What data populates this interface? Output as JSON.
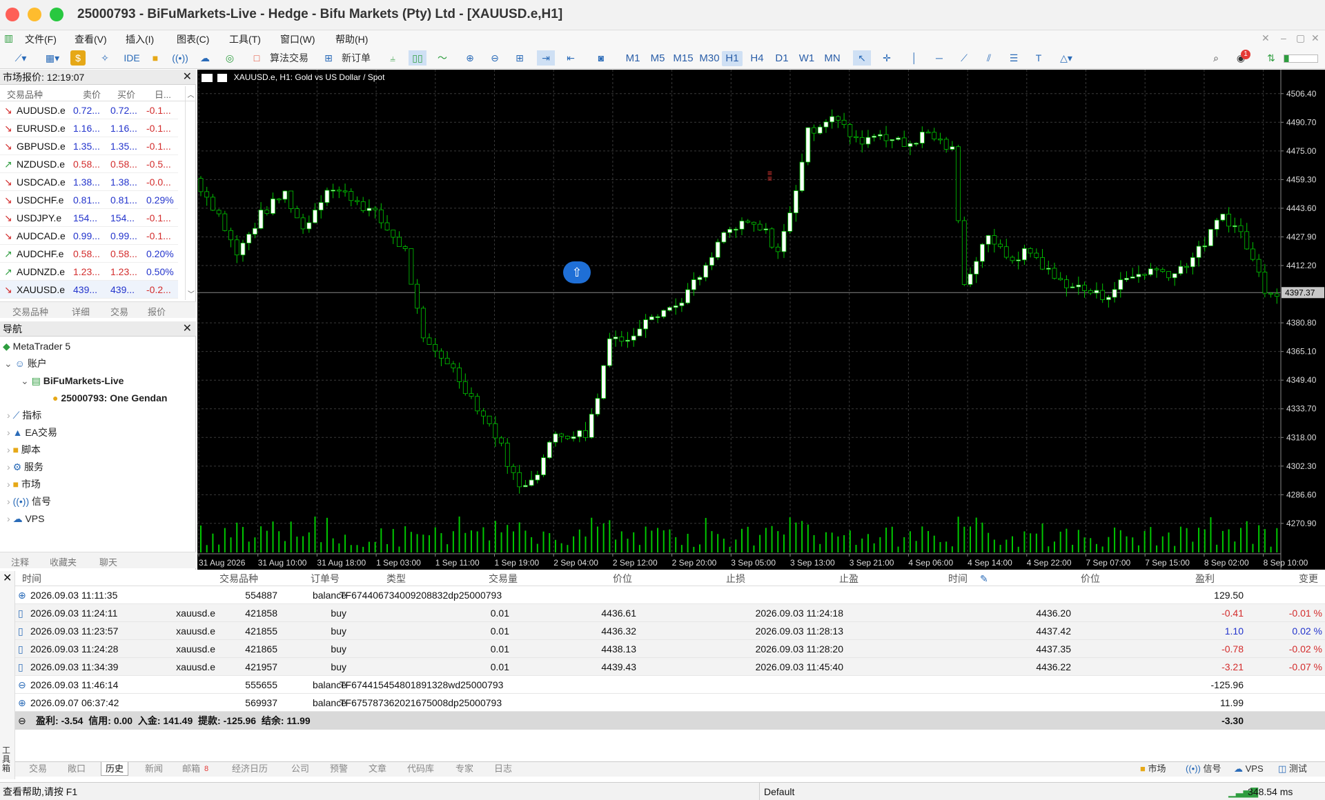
{
  "window": {
    "title": "25000793 - BiFuMarkets-Live - Hedge - Bifu Markets (Pty) Ltd - [XAUUSD.e,H1]"
  },
  "menu": [
    "文件(F)",
    "查看(V)",
    "插入(I)",
    "图表(C)",
    "工具(T)",
    "窗口(W)",
    "帮助(H)"
  ],
  "toolbar": {
    "ide_label": "IDE",
    "algo_label": "算法交易",
    "new_order_label": "新订单",
    "timeframes": [
      "M1",
      "M5",
      "M15",
      "M30",
      "H1",
      "H4",
      "D1",
      "W1",
      "MN"
    ],
    "active_timeframe": "H1",
    "notification_count": "1"
  },
  "market_watch": {
    "title": "市场报价: 12:19:07",
    "columns": [
      "交易品种",
      "卖价",
      "买价",
      "日..."
    ],
    "rows": [
      {
        "symbol": "AUDUSD.e",
        "dir": "down",
        "bid": "0.72...",
        "ask": "0.72...",
        "chg": "-0.1..."
      },
      {
        "symbol": "EURUSD.e",
        "dir": "down",
        "bid": "1.16...",
        "ask": "1.16...",
        "chg": "-0.1..."
      },
      {
        "symbol": "GBPUSD.e",
        "dir": "down",
        "bid": "1.35...",
        "ask": "1.35...",
        "chg": "-0.1..."
      },
      {
        "symbol": "NZDUSD.e",
        "dir": "up",
        "bid": "0.58...",
        "ask": "0.58...",
        "chg": "-0.5..."
      },
      {
        "symbol": "USDCAD.e",
        "dir": "down",
        "bid": "1.38...",
        "ask": "1.38...",
        "chg": "-0.0..."
      },
      {
        "symbol": "USDCHF.e",
        "dir": "down",
        "bid": "0.81...",
        "ask": "0.81...",
        "chg": "0.29%"
      },
      {
        "symbol": "USDJPY.e",
        "dir": "down",
        "bid": "154...",
        "ask": "154...",
        "chg": "-0.1..."
      },
      {
        "symbol": "AUDCAD.e",
        "dir": "down",
        "bid": "0.99...",
        "ask": "0.99...",
        "chg": "-0.1..."
      },
      {
        "symbol": "AUDCHF.e",
        "dir": "up",
        "bid": "0.58...",
        "ask": "0.58...",
        "chg": "0.20%"
      },
      {
        "symbol": "AUDNZD.e",
        "dir": "up",
        "bid": "1.23...",
        "ask": "1.23...",
        "chg": "0.50%"
      },
      {
        "symbol": "XAUUSD.e",
        "dir": "down",
        "bid": "439...",
        "ask": "439...",
        "chg": "-0.2..."
      }
    ],
    "tabs": [
      "交易品种",
      "详细",
      "交易",
      "报价"
    ]
  },
  "navigator": {
    "title": "导航",
    "items": [
      "MetaTrader 5",
      "账户",
      "BiFuMarkets-Live",
      "25000793: One Gendan",
      "指标",
      "EA交易",
      "脚本",
      "服务",
      "市场",
      "信号",
      "VPS"
    ],
    "tabs": [
      "注释",
      "收藏夹",
      "聊天"
    ]
  },
  "chart": {
    "header": "XAUUSD.e, H1:  Gold vs US Dollar / Spot",
    "price_labels": [
      "4506.40",
      "4490.70",
      "4475.00",
      "4459.30",
      "4443.60",
      "4427.90",
      "4412.20",
      "4397.37",
      "4380.80",
      "4365.10",
      "4349.40",
      "4333.70",
      "4318.00",
      "4302.30",
      "4286.60",
      "4270.90"
    ],
    "current_price": "4397.37",
    "time_labels": [
      "31 Aug 2026",
      "31 Aug 10:00",
      "31 Aug 18:00",
      "1 Sep 03:00",
      "1 Sep 11:00",
      "1 Sep 19:00",
      "2 Sep 04:00",
      "2 Sep 12:00",
      "2 Sep 20:00",
      "3 Sep 05:00",
      "3 Sep 13:00",
      "3 Sep 21:00",
      "4 Sep 06:00",
      "4 Sep 14:00",
      "4 Sep 22:00",
      "7 Sep 07:00",
      "7 Sep 15:00",
      "8 Sep 02:00",
      "8 Sep 10:00"
    ]
  },
  "history": {
    "columns": [
      "时间",
      "交易品种",
      "订单号",
      "类型",
      "交易量",
      "价位",
      "止损",
      "止盈",
      "时间",
      "价位",
      "盈利",
      "变更"
    ],
    "rows": [
      {
        "icon": "plus",
        "time": "2026.09.03 11:11:35",
        "symbol": "",
        "ticket": "554887",
        "type": "balance",
        "comment": "TF674406734009208832dp25000793",
        "volume": "",
        "price": "",
        "sl": "",
        "tp": "",
        "close_time": "",
        "close_price": "",
        "profit": "129.50",
        "change": "",
        "profit_color": "black"
      },
      {
        "icon": "doc",
        "time": "2026.09.03 11:24:11",
        "symbol": "xauusd.e",
        "ticket": "421858",
        "type": "buy",
        "comment": "",
        "volume": "0.01",
        "price": "4436.61",
        "sl": "",
        "tp": "",
        "close_time": "2026.09.03 11:24:18",
        "close_price": "4436.20",
        "profit": "-0.41",
        "change": "-0.01 %",
        "profit_color": "red"
      },
      {
        "icon": "doc",
        "time": "2026.09.03 11:23:57",
        "symbol": "xauusd.e",
        "ticket": "421855",
        "type": "buy",
        "comment": "",
        "volume": "0.01",
        "price": "4436.32",
        "sl": "",
        "tp": "",
        "close_time": "2026.09.03 11:28:13",
        "close_price": "4437.42",
        "profit": "1.10",
        "change": "0.02 %",
        "profit_color": "blue"
      },
      {
        "icon": "doc",
        "time": "2026.09.03 11:24:28",
        "symbol": "xauusd.e",
        "ticket": "421865",
        "type": "buy",
        "comment": "",
        "volume": "0.01",
        "price": "4438.13",
        "sl": "",
        "tp": "",
        "close_time": "2026.09.03 11:28:20",
        "close_price": "4437.35",
        "profit": "-0.78",
        "change": "-0.02 %",
        "profit_color": "red"
      },
      {
        "icon": "doc",
        "time": "2026.09.03 11:34:39",
        "symbol": "xauusd.e",
        "ticket": "421957",
        "type": "buy",
        "comment": "",
        "volume": "0.01",
        "price": "4439.43",
        "sl": "",
        "tp": "",
        "close_time": "2026.09.03 11:45:40",
        "close_price": "4436.22",
        "profit": "-3.21",
        "change": "-0.07 %",
        "profit_color": "red"
      },
      {
        "icon": "minus",
        "time": "2026.09.03 11:46:14",
        "symbol": "",
        "ticket": "555655",
        "type": "balance",
        "comment": "TF674415454801891328wd25000793",
        "volume": "",
        "price": "",
        "sl": "",
        "tp": "",
        "close_time": "",
        "close_price": "",
        "profit": "-125.96",
        "change": "",
        "profit_color": "black"
      },
      {
        "icon": "plus",
        "time": "2026.09.07 06:37:42",
        "symbol": "",
        "ticket": "569937",
        "type": "balance",
        "comment": "TF675787362021675008dp25000793",
        "volume": "",
        "price": "",
        "sl": "",
        "tp": "",
        "close_time": "",
        "close_price": "",
        "profit": "11.99",
        "change": "",
        "profit_color": "black"
      }
    ],
    "summary": {
      "profit_label": "盈利:",
      "profit": "-3.54",
      "credit_label": "信用:",
      "credit": "0.00",
      "deposit_label": "入金:",
      "deposit": "141.49",
      "withdraw_label": "提款:",
      "withdraw": "-125.96",
      "balance_label": "结余:",
      "balance": "11.99",
      "total": "-3.30"
    }
  },
  "toolbox": {
    "side_label": "工具箱",
    "tabs": [
      "交易",
      "敞口",
      "历史",
      "新闻",
      "邮箱",
      "经济日历",
      "公司",
      "预警",
      "文章",
      "代码库",
      "专家",
      "日志"
    ],
    "active_tab": "历史",
    "mail_count": "8",
    "right_tabs": [
      "市场",
      "信号",
      "VPS",
      "测试"
    ]
  },
  "status": {
    "help": "查看帮助,请按 F1",
    "profile": "Default",
    "ping": "348.54 ms"
  },
  "colors": {
    "up_candle": "#ffffff",
    "down_candle": "#000000",
    "wick": "#00c800",
    "volume": "#00c800",
    "chart_bg": "#000000"
  }
}
